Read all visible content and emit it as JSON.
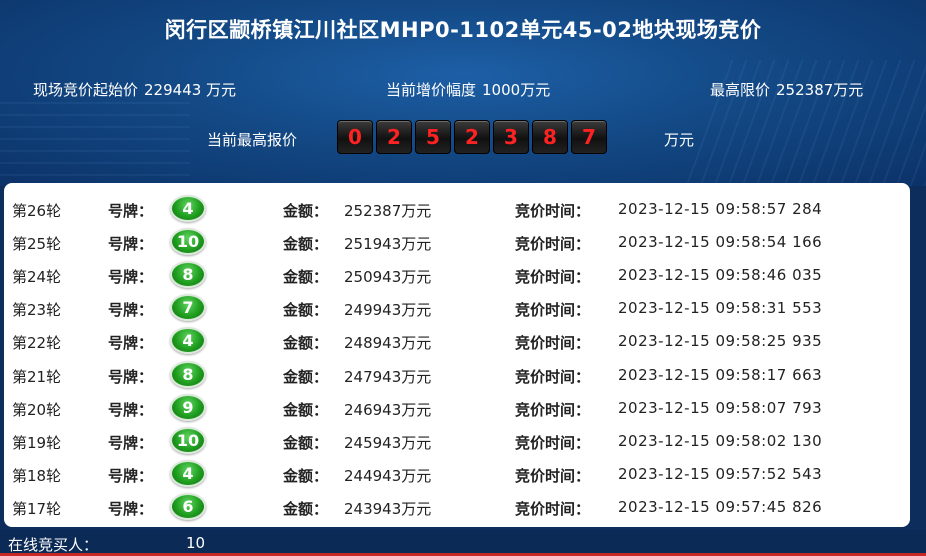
{
  "header": {
    "title": "闵行区颛桥镇江川社区MHP0-1102单元45-02地块现场竞价",
    "start_price_label": "现场竞价起始价",
    "start_price_value": "229443 万元",
    "increment_label": "当前增价幅度",
    "increment_value": "1000万元",
    "max_price_label": "最高限价",
    "max_price_value": "252387万元",
    "current_high_label": "当前最高报价",
    "current_high_digits": [
      "0",
      "2",
      "5",
      "2",
      "3",
      "8",
      "7"
    ],
    "current_high_unit": "万元"
  },
  "labels": {
    "paddle": "号牌：",
    "amount": "金额：",
    "time": "竞价时间："
  },
  "rounds": [
    {
      "round": "第26轮",
      "paddle": "4",
      "amount": "252387万元",
      "time": "2023-12-15 09:58:57 284"
    },
    {
      "round": "第25轮",
      "paddle": "10",
      "amount": "251943万元",
      "time": "2023-12-15 09:58:54 166"
    },
    {
      "round": "第24轮",
      "paddle": "8",
      "amount": "250943万元",
      "time": "2023-12-15 09:58:46 035"
    },
    {
      "round": "第23轮",
      "paddle": "7",
      "amount": "249943万元",
      "time": "2023-12-15 09:58:31 553"
    },
    {
      "round": "第22轮",
      "paddle": "4",
      "amount": "248943万元",
      "time": "2023-12-15 09:58:25 935"
    },
    {
      "round": "第21轮",
      "paddle": "8",
      "amount": "247943万元",
      "time": "2023-12-15 09:58:17 663"
    },
    {
      "round": "第20轮",
      "paddle": "9",
      "amount": "246943万元",
      "time": "2023-12-15 09:58:07 793"
    },
    {
      "round": "第19轮",
      "paddle": "10",
      "amount": "245943万元",
      "time": "2023-12-15 09:58:02 130"
    },
    {
      "round": "第18轮",
      "paddle": "4",
      "amount": "244943万元",
      "time": "2023-12-15 09:57:52 543"
    },
    {
      "round": "第17轮",
      "paddle": "6",
      "amount": "243943万元",
      "time": "2023-12-15 09:57:45 826"
    }
  ],
  "footer": {
    "online_label": "在线竞买人：",
    "online_count": "10"
  },
  "colors": {
    "header_bg": "#134985",
    "digit_text": "#ff2222",
    "badge_green": "#1f9e1f",
    "footer_bg": "#0b2a55"
  }
}
